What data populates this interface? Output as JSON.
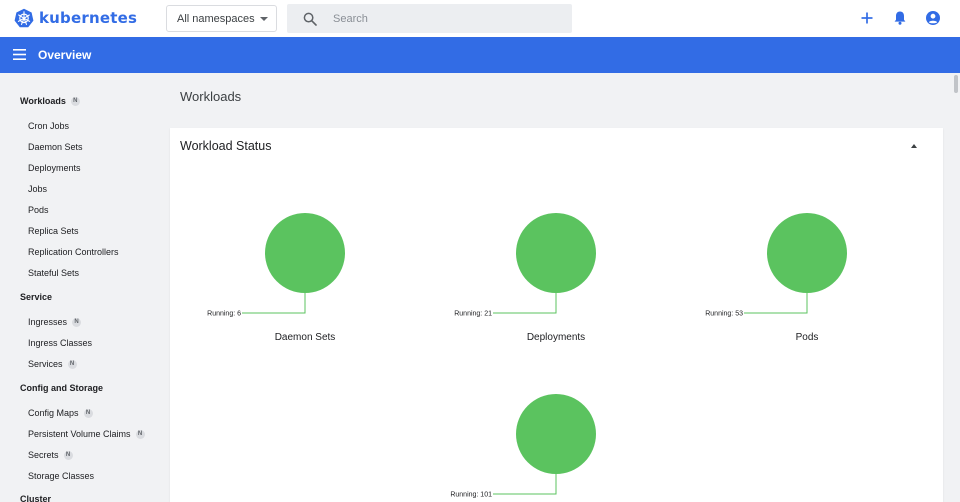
{
  "app": {
    "name": "kubernetes",
    "brand_color": "#326ce5"
  },
  "topbar": {
    "namespace_selected": "All namespaces",
    "search_placeholder": "Search",
    "icons": [
      "add-icon",
      "notifications-bell-icon",
      "account-circle-icon"
    ]
  },
  "header": {
    "title": "Overview"
  },
  "sidebar": {
    "sections": [
      {
        "label": "Workloads",
        "badge": "N",
        "items": [
          {
            "label": "Cron Jobs"
          },
          {
            "label": "Daemon Sets"
          },
          {
            "label": "Deployments"
          },
          {
            "label": "Jobs"
          },
          {
            "label": "Pods"
          },
          {
            "label": "Replica Sets"
          },
          {
            "label": "Replication Controllers"
          },
          {
            "label": "Stateful Sets"
          }
        ]
      },
      {
        "label": "Service",
        "items": [
          {
            "label": "Ingresses",
            "badge": "N"
          },
          {
            "label": "Ingress Classes"
          },
          {
            "label": "Services",
            "badge": "N"
          }
        ]
      },
      {
        "label": "Config and Storage",
        "items": [
          {
            "label": "Config Maps",
            "badge": "N"
          },
          {
            "label": "Persistent Volume Claims",
            "badge": "N"
          },
          {
            "label": "Secrets",
            "badge": "N"
          },
          {
            "label": "Storage Classes"
          }
        ]
      },
      {
        "label": "Cluster",
        "items": []
      }
    ]
  },
  "main": {
    "page_title": "Workloads",
    "card_title": "Workload Status"
  },
  "chart_data": [
    {
      "type": "pie",
      "title": "Daemon Sets",
      "slices": [
        {
          "label": "Running: 6",
          "value": 6,
          "color": "#5bc35f"
        }
      ]
    },
    {
      "type": "pie",
      "title": "Deployments",
      "slices": [
        {
          "label": "Running: 21",
          "value": 21,
          "color": "#5bc35f"
        }
      ]
    },
    {
      "type": "pie",
      "title": "Pods",
      "slices": [
        {
          "label": "Running: 53",
          "value": 53,
          "color": "#5bc35f"
        }
      ]
    },
    {
      "type": "pie",
      "title": "",
      "slices": [
        {
          "label": "Running: 101",
          "value": 101,
          "color": "#5bc35f"
        }
      ]
    }
  ]
}
